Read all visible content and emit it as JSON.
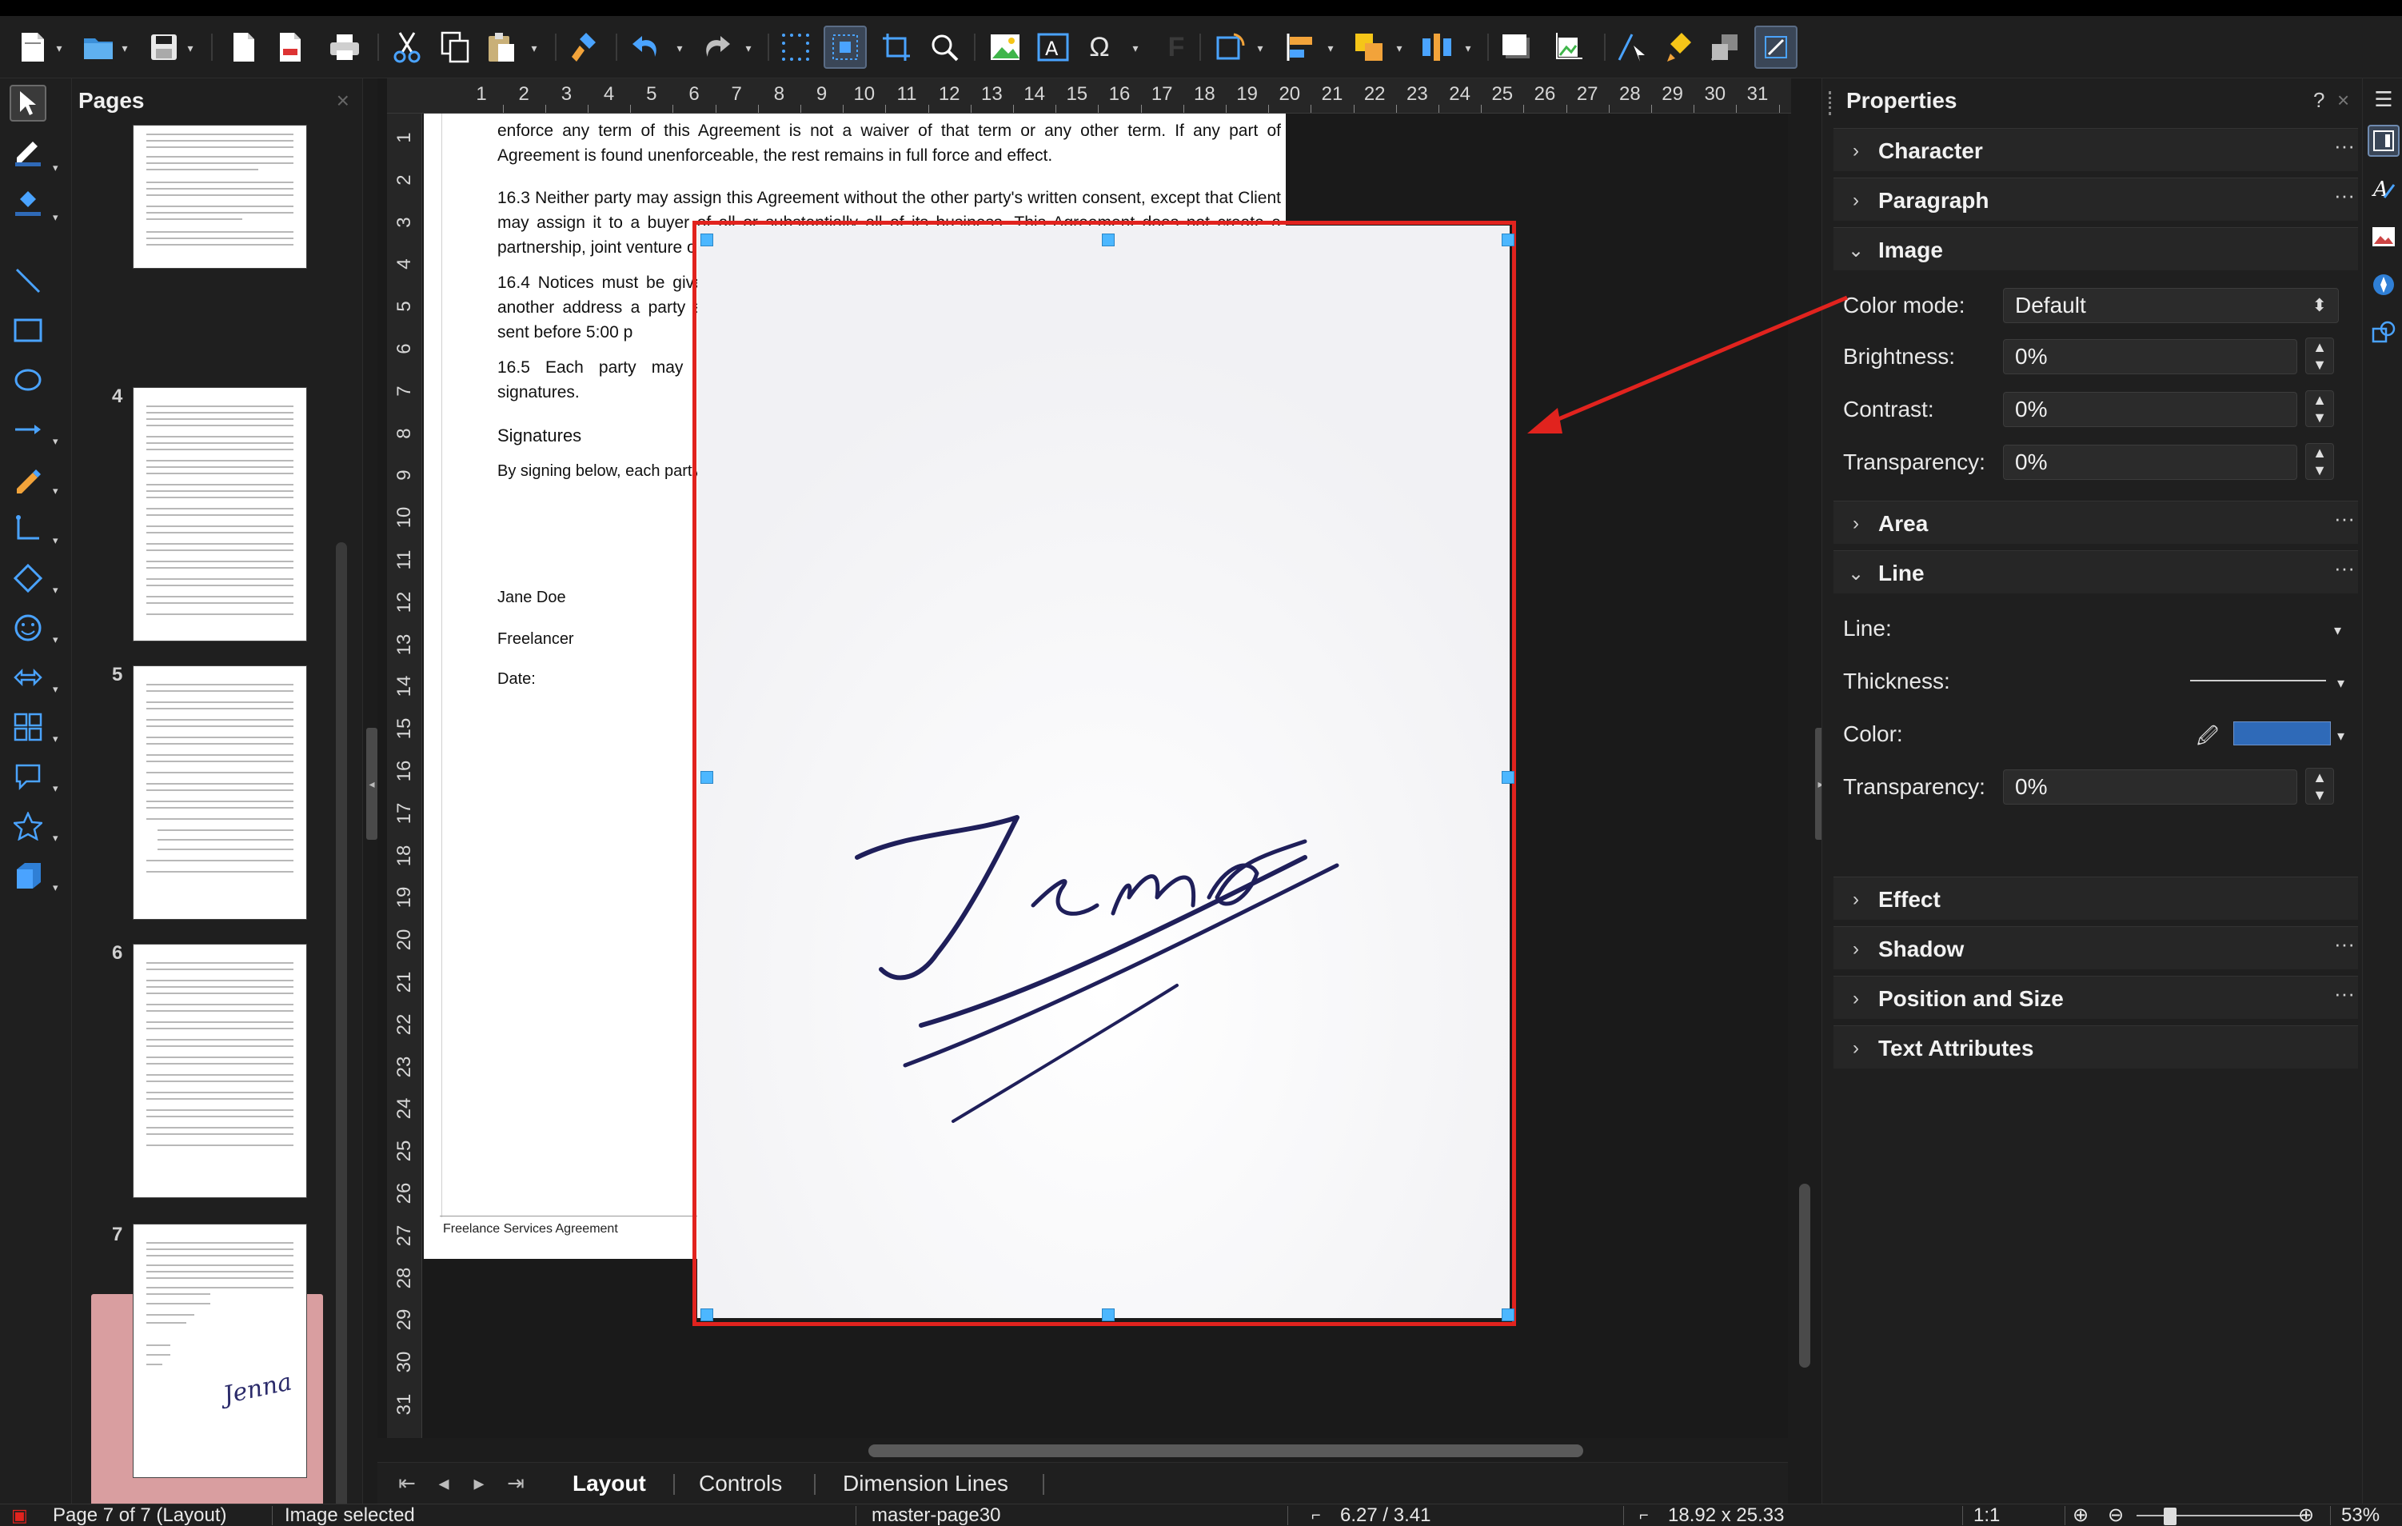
{
  "toolbar": {
    "icons": [
      "new-document-icon",
      "open-folder-icon",
      "save-icon",
      "export-pdf-icon",
      "export-directly-icon",
      "print-icon",
      "cut-icon",
      "copy-icon",
      "paste-icon",
      "clone-formatting-icon",
      "undo-icon",
      "redo-icon",
      "grid-icon",
      "snap-guides-icon",
      "crop-icon",
      "zoom-pan-icon",
      "insert-image-icon",
      "insert-textbox-icon",
      "special-character-icon",
      "fontwork-icon",
      "transformations-icon",
      "align-objects-icon",
      "arrange-icon",
      "distribute-icon",
      "shadow-icon",
      "crop-image-icon",
      "points-icon",
      "glue-points-icon",
      "toggle-extrusion-icon",
      "show-draw-functions-icon"
    ]
  },
  "left_tools": {
    "icons": [
      "select-icon",
      "line-color-icon",
      "fill-color-icon",
      "line-icon",
      "rectangle-icon",
      "ellipse-icon",
      "line-arrow-icon",
      "curve-icon",
      "connector-icon",
      "basic-shapes-icon",
      "symbol-shapes-icon",
      "block-arrows-icon",
      "flowchart-icon",
      "callout-icon",
      "stars-icon",
      "3d-objects-icon"
    ]
  },
  "pages_panel": {
    "title": "Pages",
    "close": "×",
    "thumbnails": [
      {
        "number": ""
      },
      {
        "number": "4"
      },
      {
        "number": "5"
      },
      {
        "number": "6"
      },
      {
        "number": "7"
      }
    ],
    "thumb_signature": "Jenna"
  },
  "ruler": {
    "h_ticks": [
      "1",
      "2",
      "3",
      "4",
      "5",
      "6",
      "7",
      "8",
      "9",
      "10",
      "11",
      "12",
      "13",
      "14",
      "15",
      "16",
      "17",
      "18",
      "19",
      "20",
      "21",
      "22",
      "23",
      "24",
      "25",
      "26",
      "27",
      "28",
      "29",
      "30",
      "31"
    ],
    "v_ticks": [
      "1",
      "2",
      "3",
      "4",
      "5",
      "6",
      "7",
      "8",
      "9",
      "10",
      "11",
      "12",
      "13",
      "14",
      "15",
      "16",
      "17",
      "18",
      "19",
      "20",
      "21",
      "22",
      "23",
      "24",
      "25",
      "26",
      "27",
      "28",
      "29",
      "30",
      "31"
    ]
  },
  "document": {
    "para_top": "enforce any term of this Agreement is not a waiver of that term or any other term. If any part of Agreement is found unenforceable, the rest remains in full force and effect.",
    "para_16_3": "16.3 Neither party may assign this Agreement without the other party's written consent, except that Client may assign it to a buyer of all or substantially all of its business. This Agreement does not create a partnership, joint venture or",
    "para_16_4": "16.4 Notices must be given i or to another address a party sending if sent before 5:00 p",
    "para_16_5": "16.5 Each party may sign signatures.",
    "signatures_heading": "Signatures",
    "signatures_intro": "By signing below, each party",
    "signer_name": "Jane Doe",
    "signer_role": "Freelancer",
    "date_label": "Date:",
    "footer": "Freelance Services Agreement"
  },
  "signature_image": {
    "text": "Jenna",
    "ink_color": "#1f1f5a"
  },
  "tabs": {
    "items": [
      "Layout",
      "Controls",
      "Dimension Lines"
    ],
    "active": "Layout"
  },
  "properties": {
    "title": "Properties",
    "help": "?",
    "close": "×",
    "sections": {
      "character": "Character",
      "paragraph": "Paragraph",
      "image": "Image",
      "area": "Area",
      "line": "Line",
      "effect": "Effect",
      "shadow": "Shadow",
      "position_size": "Position and Size",
      "text_attributes": "Text Attributes"
    },
    "image": {
      "color_mode_label": "Color mode:",
      "color_mode_value": "Default",
      "brightness_label": "Brightness:",
      "brightness_value": "0%",
      "contrast_label": "Contrast:",
      "contrast_value": "0%",
      "transparency_label": "Transparency:",
      "transparency_value": "0%"
    },
    "line": {
      "line_label": "Line:",
      "thickness_label": "Thickness:",
      "color_label": "Color:",
      "color_value": "#2f6ab8",
      "transparency_label": "Transparency:",
      "transparency_value": "0%"
    }
  },
  "deck": {
    "icons": [
      "properties-deck-icon",
      "styles-deck-icon",
      "gallery-deck-icon",
      "navigator-deck-icon",
      "shapes-deck-icon"
    ]
  },
  "statusbar": {
    "page": "Page 7 of 7 (Layout)",
    "selection": "Image selected",
    "master": "master-page30",
    "position": "6.27 / 3.41",
    "size": "18.92 x 25.33",
    "scale": "1:1",
    "zoom": "53%"
  },
  "colors": {
    "accent": "#4aa3ff",
    "frame": "#e1231e",
    "selected_thumb": "#d99ea0",
    "handles": "#4cb7ff"
  }
}
